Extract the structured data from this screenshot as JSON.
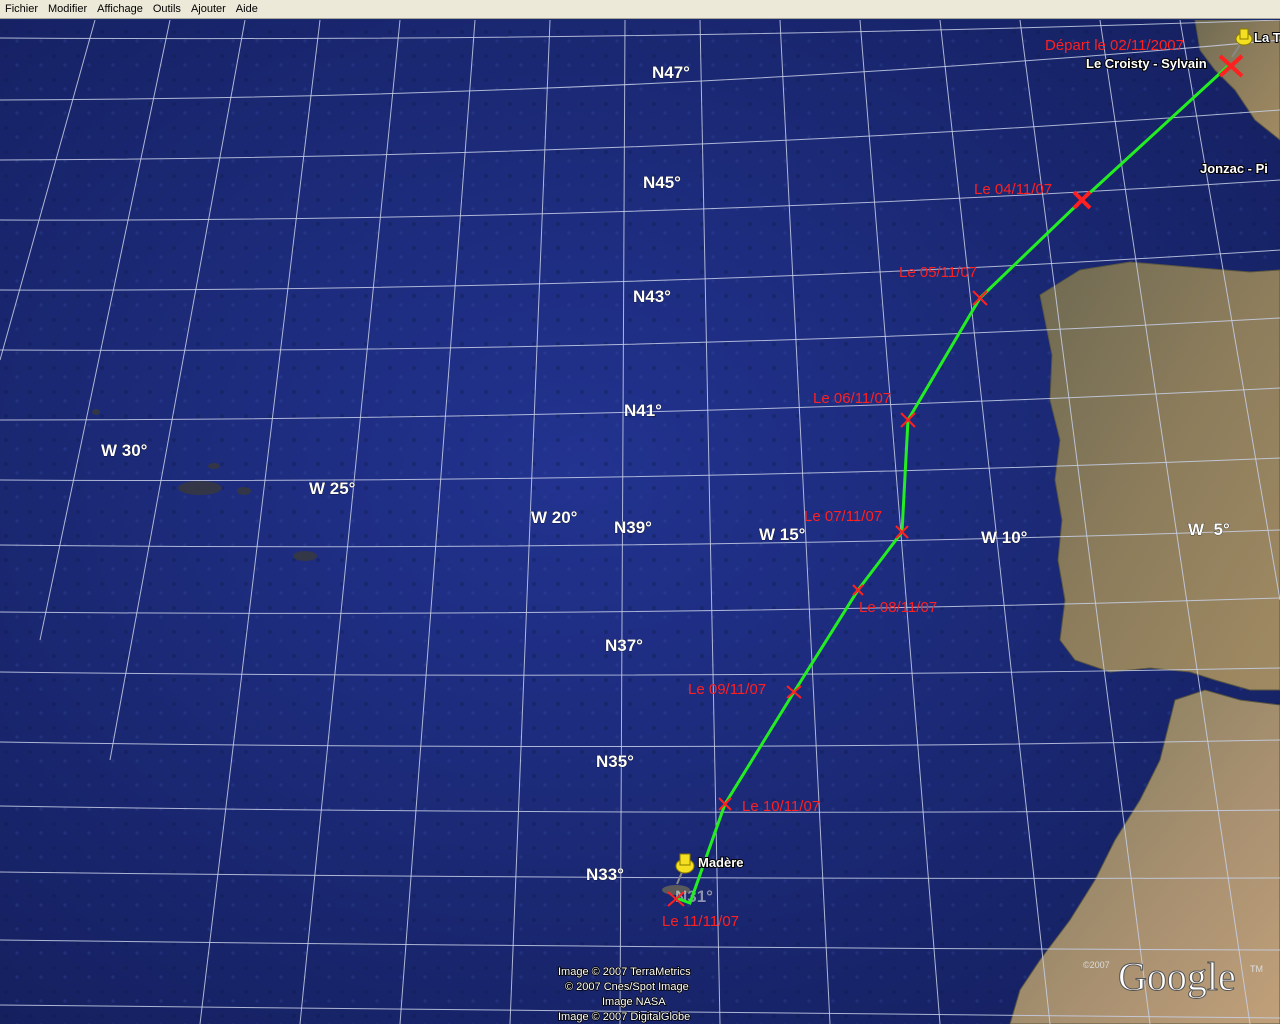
{
  "menu": [
    "Fichier",
    "Modifier",
    "Affichage",
    "Outils",
    "Ajouter",
    "Aide"
  ],
  "latitude_labels": [
    "N47°",
    "N45°",
    "N43°",
    "N41°",
    "N39°",
    "N37°",
    "N35°",
    "N33°",
    "N31°"
  ],
  "longitude_labels": [
    "W 30°",
    "W 25°",
    "W 20°",
    "W 15°",
    "W 10°",
    "W  5°"
  ],
  "route_labels": {
    "depart": "Départ le 02/11/2007",
    "d04": "Le 04/11/07",
    "d05": "Le 05/11/07",
    "d06": "Le 06/11/07",
    "d07": "Le 07/11/07",
    "d08": "Le 08/11/07",
    "d09": "Le 09/11/07",
    "d10": "Le 10/11/07",
    "d11": "Le 11/11/07"
  },
  "places": {
    "croisty": "Le Croisty - Sylvain",
    "jonzac": "Jonzac - Pi",
    "la_t": "La T",
    "madere": "Madère"
  },
  "credits": [
    "Image © 2007 TerraMetrics",
    "© 2007 Cnes/Spot Image",
    "Image NASA",
    "Image © 2007 DigitalGlobe"
  ],
  "copyright_small": "©2007",
  "logo": "Google",
  "logo_tm": "TM",
  "colors": {
    "ocean": "#1e2c78",
    "route": "#22ee22",
    "marker": "#ff2020",
    "land": "#8a7a5a",
    "grid": "#c8d0e8"
  },
  "icons": [
    "pushpin-icon",
    "cross-marker-icon"
  ]
}
